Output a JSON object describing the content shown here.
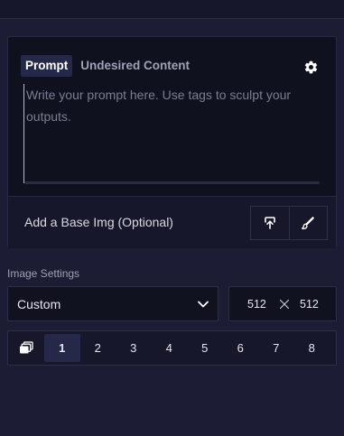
{
  "prompt": {
    "tabs": [
      {
        "label": "Prompt",
        "active": true
      },
      {
        "label": "Undesired Content",
        "active": false
      }
    ],
    "settings_icon": "gear-icon",
    "placeholder": "Write your prompt here. Use tags to sculpt your outputs.",
    "value": ""
  },
  "base_image": {
    "label": "Add a Base Img (Optional)",
    "buttons": [
      {
        "icon": "upload-icon"
      },
      {
        "icon": "paint-brush-icon"
      }
    ]
  },
  "image_settings": {
    "label": "Image Settings",
    "preset": "Custom",
    "width": "512",
    "height": "512",
    "sample_icon": "images-stack-icon",
    "counts": [
      "1",
      "2",
      "3",
      "4",
      "5",
      "6",
      "7",
      "8"
    ],
    "selected_count": "1"
  },
  "colors": {
    "background": "#1c1d34",
    "card": "#10111f",
    "active_tab": "#252848",
    "text": "#e6e7ee",
    "muted_text": "#a0a2b3"
  }
}
